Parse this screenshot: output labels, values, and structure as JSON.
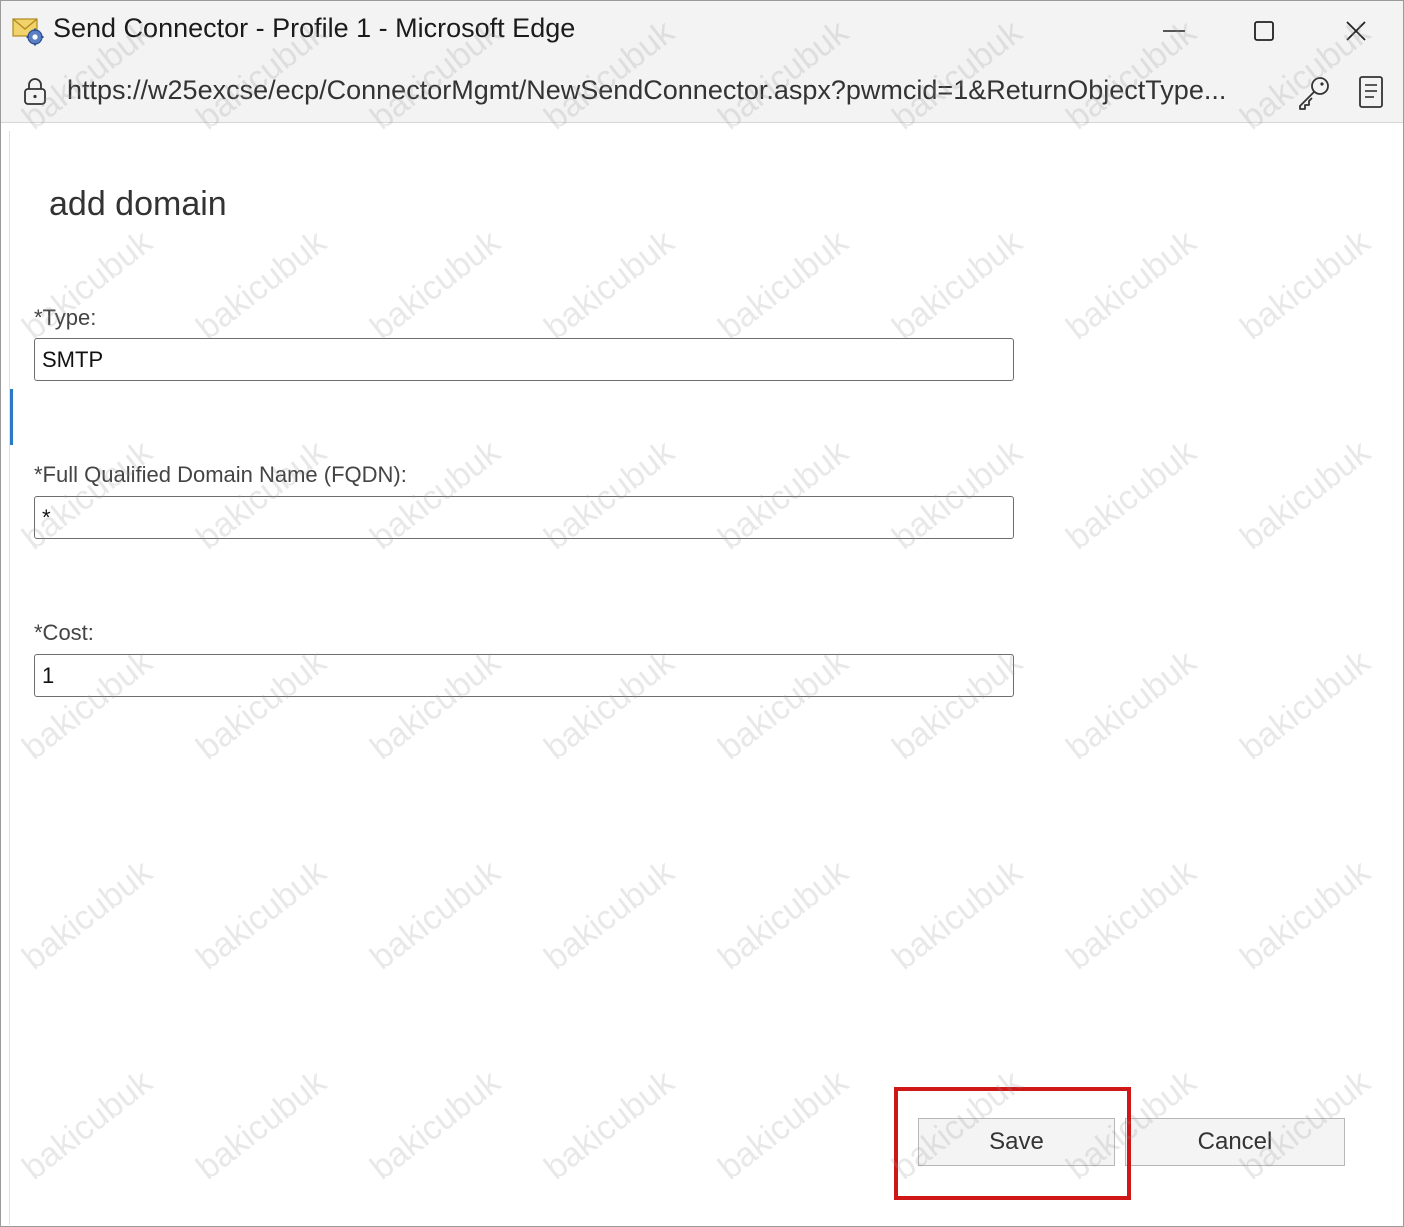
{
  "window": {
    "title": "Send Connector - Profile 1 - Microsoft Edge"
  },
  "browser": {
    "url": "https://w25excse/ecp/ConnectorMgmt/NewSendConnector.aspx?pwmcid=1&ReturnObjectType..."
  },
  "icons": {
    "app": "envelope-gear-icon",
    "lock": "lock-icon",
    "key": "key-icon",
    "reader": "reader-view-icon",
    "minimize": "minimize-icon",
    "maximize": "maximize-icon",
    "close": "close-icon"
  },
  "dialog": {
    "title": "add domain",
    "fields": {
      "type": {
        "label": "*Type:",
        "value": "SMTP"
      },
      "fqdn": {
        "label": "*Full Qualified Domain Name (FQDN):",
        "value": "*"
      },
      "cost": {
        "label": "*Cost:",
        "value": "1"
      }
    },
    "buttons": {
      "save": "Save",
      "cancel": "Cancel"
    }
  },
  "watermark": "bakicubuk",
  "colors": {
    "highlight": "#d01717",
    "accent": "#2a7ac6"
  }
}
